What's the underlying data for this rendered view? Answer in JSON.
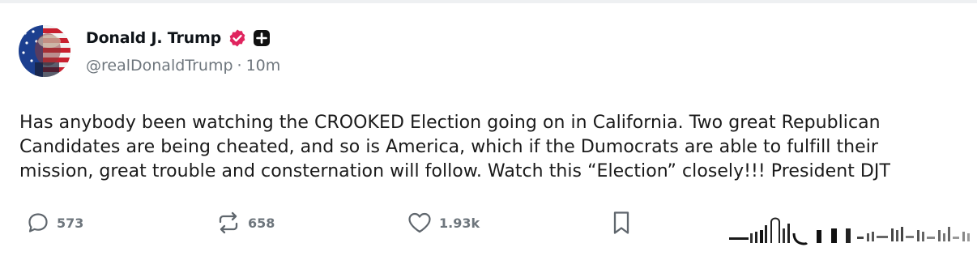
{
  "author": {
    "display_name": "Donald J. Trump",
    "handle": "@realDonaldTrump",
    "separator": "·",
    "time_ago": "10m"
  },
  "post": {
    "text": "Has anybody been watching the CROOKED Election going on in California. Two great Republican Candidates are being cheated, and so is America, which if the Dumocrats are able to fulfill their mission, great trouble and consternation will follow. Watch this “Election” closely!!! President DJT"
  },
  "actions": {
    "replies": "573",
    "reposts": "658",
    "likes": "1.93k"
  },
  "icons": {
    "reply": "speech-bubble-icon",
    "repost": "repost-arrows-icon",
    "like": "heart-icon",
    "bookmark": "bookmark-icon",
    "verified": "verified-badge-icon",
    "plus": "plus-badge-icon"
  },
  "colors": {
    "verified_badge": "#e0245e",
    "text": "#0f1419",
    "muted": "#6e767d"
  }
}
